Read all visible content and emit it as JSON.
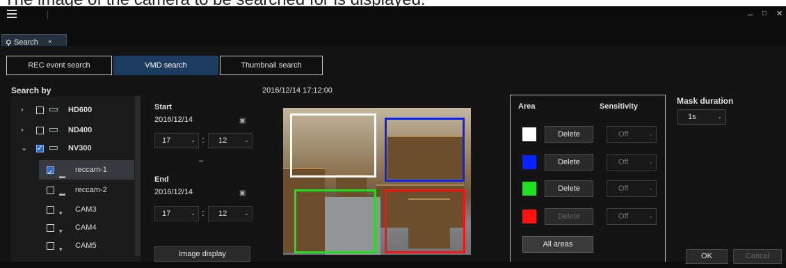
{
  "caption": "The image of the camera to be searched for is displayed.",
  "window": {
    "minimize": "–",
    "maximize": "□",
    "close": "✕"
  },
  "tab": {
    "label": "Search",
    "close": "×"
  },
  "modes": [
    "REC event search",
    "VMD search",
    "Thumbnail search"
  ],
  "active_mode": "VMD search",
  "search_by": {
    "title": "Search by",
    "tree": [
      {
        "label": "HD600",
        "expand": "›",
        "checked": false,
        "selected": false
      },
      {
        "label": "ND400",
        "expand": "›",
        "checked": false,
        "selected": false
      },
      {
        "label": "NV300",
        "expand": "⌄",
        "checked": true,
        "selected": false
      },
      {
        "label": "reccam-1",
        "checked": true,
        "selected": true
      },
      {
        "label": "reccam-2",
        "checked": false,
        "selected": false
      },
      {
        "label": "CAM3",
        "checked": false,
        "selected": false
      },
      {
        "label": "CAM4",
        "checked": false,
        "selected": false
      },
      {
        "label": "CAM5",
        "checked": false,
        "selected": false
      }
    ]
  },
  "start": {
    "label": "Start",
    "date": "2016/12/14",
    "hour": "17",
    "minute": "12"
  },
  "range_sep": "~",
  "time_sep": ":",
  "end": {
    "label": "End",
    "date": "2016/12/14",
    "hour": "17",
    "minute": "12"
  },
  "image_display_button": "Image display",
  "timestamp": "2016/12/14 17:12:00",
  "areas": {
    "area_header": "Area",
    "sensitivity_header": "Sensitivity",
    "rows": [
      {
        "color": "#ffffff",
        "delete": "Delete",
        "sensitivity": "Off",
        "delete_disabled": false
      },
      {
        "color": "#0a22ff",
        "delete": "Delete",
        "sensitivity": "Off",
        "delete_disabled": false
      },
      {
        "color": "#1fe01f",
        "delete": "Delete",
        "sensitivity": "Off",
        "delete_disabled": false
      },
      {
        "color": "#ff1111",
        "delete": "Delete",
        "sensitivity": "Off",
        "delete_disabled": true
      }
    ],
    "all_areas_button": "All areas"
  },
  "mask": {
    "title": "Mask duration",
    "value": "1s"
  },
  "ok_button": "OK",
  "cancel_button": "Cancel",
  "colors": {
    "accent": "#1d3b5e",
    "background": "#141414"
  }
}
